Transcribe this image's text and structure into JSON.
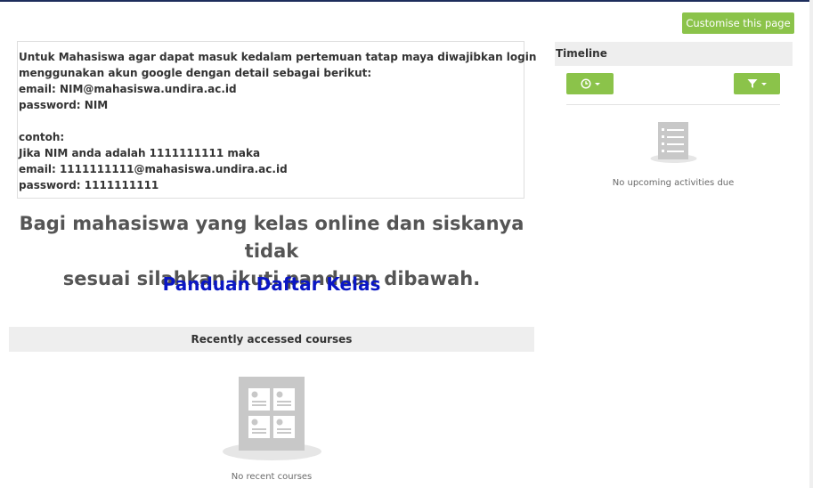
{
  "header": {
    "customise_label": "Customise this page"
  },
  "notice": {
    "lines": [
      "Untuk Mahasiswa agar dapat masuk kedalam pertemuan tatap maya diwajibkan login",
      "menggunakan akun google dengan detail sebagai berikut:",
      "email: NIM@mahasiswa.undira.ac.id",
      "password: NIM",
      "contoh:",
      "Jika NIM anda adalah 1111111111 maka",
      "email: 1111111111@mahasiswa.undira.ac.id",
      "password: 1111111111"
    ]
  },
  "announcement": {
    "line1": "Bagi mahasiswa yang kelas online dan siskanya tidak",
    "line2": "sesuai silahkan ikuti panduan dibawah.",
    "link_label": "Panduan Daftar Kelas"
  },
  "recent_courses": {
    "title": "Recently accessed courses",
    "empty_text": "No recent courses"
  },
  "timeline": {
    "title": "Timeline",
    "sort_icon": "clock-icon",
    "filter_icon": "filter-icon",
    "empty_text": "No upcoming activities due"
  },
  "colors": {
    "accent_green": "#8bc34a",
    "link_blue": "#0a16c4",
    "top_bar": "#1d2d5c"
  }
}
